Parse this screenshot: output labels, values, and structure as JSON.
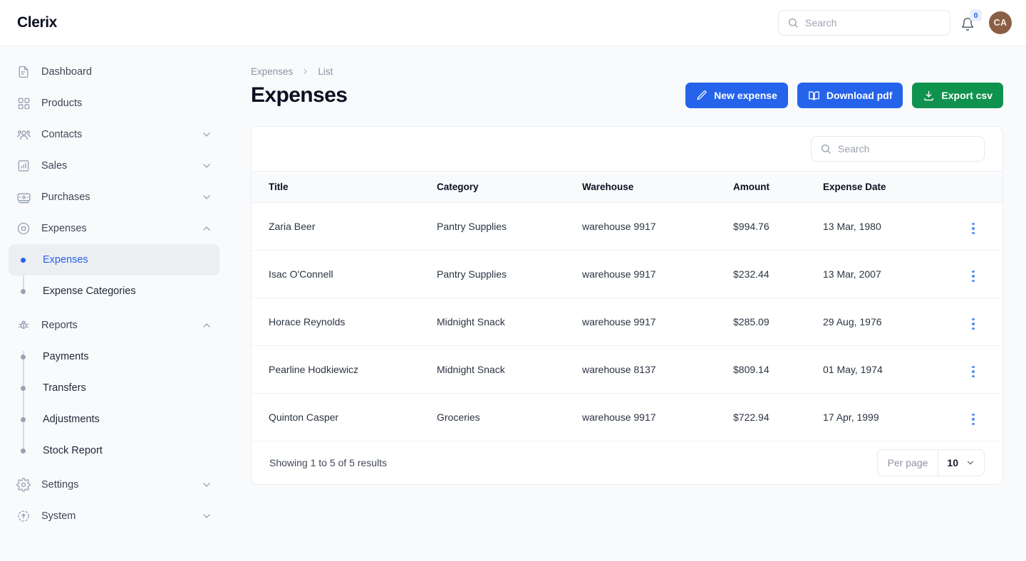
{
  "brand": "Clerix",
  "topbar": {
    "search_placeholder": "Search",
    "search_value": "",
    "notification_count": "0",
    "avatar_initials": "CA"
  },
  "sidebar": {
    "items": [
      {
        "label": "Dashboard",
        "icon": "document-icon",
        "expandable": false
      },
      {
        "label": "Products",
        "icon": "grid-icon",
        "expandable": false
      },
      {
        "label": "Contacts",
        "icon": "users-icon",
        "expandable": true,
        "expanded": false
      },
      {
        "label": "Sales",
        "icon": "bar-chart-icon",
        "expandable": true,
        "expanded": false
      },
      {
        "label": "Purchases",
        "icon": "card-icon",
        "expandable": true,
        "expanded": false
      },
      {
        "label": "Expenses",
        "icon": "circle-square-icon",
        "expandable": true,
        "expanded": true
      }
    ],
    "expenses_children": [
      {
        "label": "Expenses",
        "active": true
      },
      {
        "label": "Expense Categories",
        "active": false
      }
    ],
    "reports": {
      "label": "Reports",
      "icon": "bug-icon",
      "expandable": true,
      "expanded": true
    },
    "reports_children": [
      {
        "label": "Payments",
        "active": false
      },
      {
        "label": "Transfers",
        "active": false
      },
      {
        "label": "Adjustments",
        "active": false
      },
      {
        "label": "Stock Report",
        "active": false
      }
    ],
    "footer_items": [
      {
        "label": "Settings",
        "icon": "gear-icon",
        "expandable": true,
        "expanded": false
      },
      {
        "label": "System",
        "icon": "system-icon",
        "expandable": true,
        "expanded": false
      }
    ]
  },
  "breadcrumb": {
    "parent": "Expenses",
    "separator": ">",
    "current": "List"
  },
  "page": {
    "title": "Expenses"
  },
  "actions": {
    "new_expense": "New expense",
    "download_pdf": "Download pdf",
    "export_csv": "Export csv"
  },
  "table": {
    "search_placeholder": "Search",
    "search_value": "",
    "columns": [
      "Title",
      "Category",
      "Warehouse",
      "Amount",
      "Expense Date"
    ],
    "rows": [
      {
        "title": "Zaria Beer",
        "category": "Pantry Supplies",
        "warehouse": "warehouse 9917",
        "amount": "$994.76",
        "date": "13 Mar, 1980"
      },
      {
        "title": "Isac O'Connell",
        "category": "Pantry Supplies",
        "warehouse": "warehouse 9917",
        "amount": "$232.44",
        "date": "13 Mar, 2007"
      },
      {
        "title": "Horace Reynolds",
        "category": "Midnight Snack",
        "warehouse": "warehouse 9917",
        "amount": "$285.09",
        "date": "29 Aug, 1976"
      },
      {
        "title": "Pearline Hodkiewicz",
        "category": "Midnight Snack",
        "warehouse": "warehouse 8137",
        "amount": "$809.14",
        "date": "01 May, 1974"
      },
      {
        "title": "Quinton Casper",
        "category": "Groceries",
        "warehouse": "warehouse 9917",
        "amount": "$722.94",
        "date": "17 Apr, 1999"
      }
    ]
  },
  "footer": {
    "results_text": "Showing 1 to 5 of 5 results",
    "per_page_label": "Per page",
    "per_page_value": "10"
  },
  "colors": {
    "accent_blue": "#2563eb",
    "accent_green": "#10924f",
    "page_bg": "#f8fafc",
    "avatar_bg": "#8a5f46"
  }
}
